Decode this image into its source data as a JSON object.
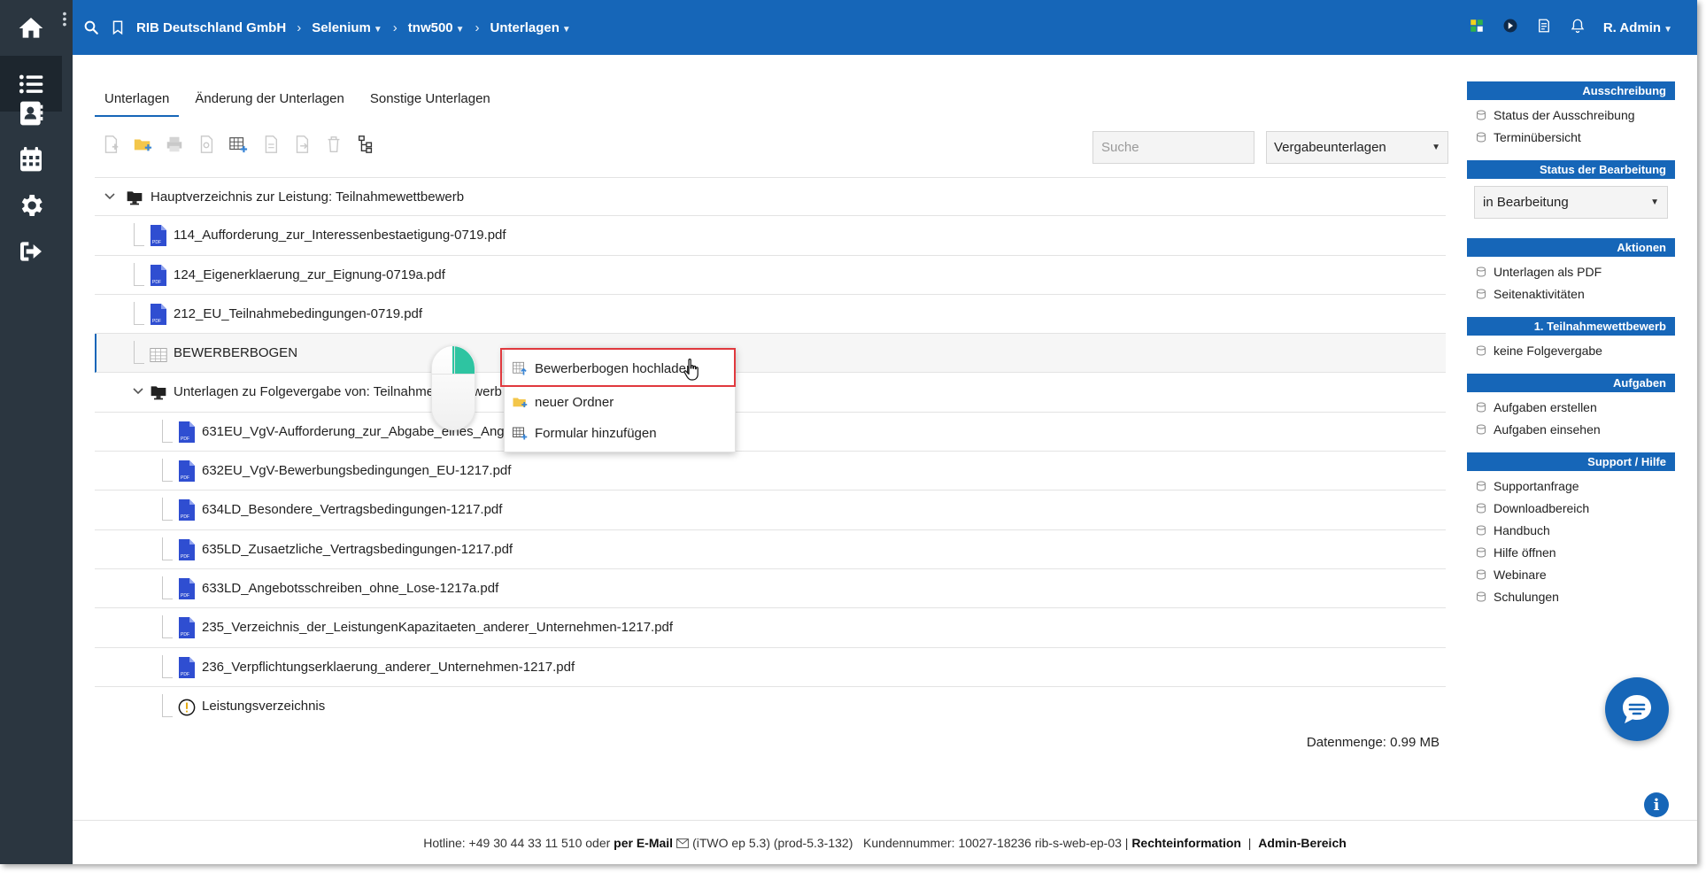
{
  "header": {
    "crumbs": [
      {
        "label": "RIB Deutschland GmbH",
        "dropdown": false
      },
      {
        "label": "Selenium",
        "dropdown": true
      },
      {
        "label": "tnw500",
        "dropdown": true
      },
      {
        "label": "Unterlagen",
        "dropdown": true
      }
    ],
    "user": "R. Admin"
  },
  "rail": [
    "home-icon",
    "list-icon",
    "contacts-icon",
    "calendar-icon",
    "gear-icon",
    "logout-icon"
  ],
  "tabs": [
    {
      "label": "Unterlagen",
      "active": true
    },
    {
      "label": "Änderung der Unterlagen",
      "active": false
    },
    {
      "label": "Sonstige Unterlagen",
      "active": false
    }
  ],
  "toolbar": {
    "search_placeholder": "Suche",
    "filter_value": "Vergabeunterlagen"
  },
  "tree": [
    {
      "label": "Hauptverzeichnis zur Leistung: Teilnahmewettbewerb",
      "type": "folder",
      "level": 0,
      "expanded": true
    },
    {
      "label": "114_Aufforderung_zur_Interessenbestaetigung-0719.pdf",
      "type": "pdf",
      "level": 1
    },
    {
      "label": "124_Eigenerklaerung_zur_Eignung-0719a.pdf",
      "type": "pdf",
      "level": 1
    },
    {
      "label": "212_EU_Teilnahmebedingungen-0719.pdf",
      "type": "pdf",
      "level": 1
    },
    {
      "label": "BEWERBERBOGEN",
      "type": "form",
      "level": 1,
      "selected": true
    },
    {
      "label": "Unterlagen zu Folgevergabe von: Teilnahmewettbewerb",
      "type": "folder",
      "level": 1,
      "expanded": true
    },
    {
      "label": "631EU_VgV-Aufforderung_zur_Abgabe_eines_Angebots-1217.pdf",
      "type": "pdf",
      "level": 2
    },
    {
      "label": "632EU_VgV-Bewerbungsbedingungen_EU-1217.pdf",
      "type": "pdf",
      "level": 2
    },
    {
      "label": "634LD_Besondere_Vertragsbedingungen-1217.pdf",
      "type": "pdf",
      "level": 2
    },
    {
      "label": "635LD_Zusaetzliche_Vertragsbedingungen-1217.pdf",
      "type": "pdf",
      "level": 2
    },
    {
      "label": "633LD_Angebotsschreiben_ohne_Lose-1217a.pdf",
      "type": "pdf",
      "level": 2
    },
    {
      "label": "235_Verzeichnis_der_LeistungenKapazitaeten_anderer_Unternehmen-1217.pdf",
      "type": "pdf",
      "level": 2
    },
    {
      "label": "236_Verpflichtungserklaerung_anderer_Unternehmen-1217.pdf",
      "type": "pdf",
      "level": 2
    },
    {
      "label": "Leistungsverzeichnis",
      "type": "warning",
      "level": 2
    }
  ],
  "datasize": "Datenmenge: 0.99 MB",
  "context_menu": [
    {
      "label": "Bewerberbogen hochladen",
      "icon": "upload-form-icon",
      "highlighted": true
    },
    {
      "label": "neuer Ordner",
      "icon": "new-folder-icon"
    },
    {
      "label": "Formular hinzufügen",
      "icon": "add-form-icon"
    }
  ],
  "panel": {
    "ausschreibung": {
      "title": "Ausschreibung",
      "links": [
        "Status der Ausschreibung",
        "Terminübersicht"
      ]
    },
    "status": {
      "title": "Status der Bearbeitung",
      "value": "in Bearbeitung"
    },
    "aktionen": {
      "title": "Aktionen",
      "links": [
        "Unterlagen als PDF",
        "Seitenaktivitäten"
      ]
    },
    "teilnahme": {
      "title": "1. Teilnahmewettbewerb",
      "links": [
        "keine Folgevergabe"
      ]
    },
    "aufgaben": {
      "title": "Aufgaben",
      "links": [
        "Aufgaben erstellen",
        "Aufgaben einsehen"
      ]
    },
    "support": {
      "title": "Support / Hilfe",
      "links": [
        "Supportanfrage",
        "Downloadbereich",
        "Handbuch",
        "Hilfe öffnen",
        "Webinare",
        "Schulungen"
      ]
    }
  },
  "footer": {
    "hotline": "Hotline: +49 30 44 33 11 510 oder",
    "mail_label": "per E-Mail",
    "version": "(iTWO ep 5.3) (prod-5.3-132)",
    "customer": "Kundennummer: 10027-18236 rib-s-web-ep-03 |",
    "legal": "Rechteinformation",
    "sep": "|",
    "admin": "Admin-Bereich"
  },
  "colors": {
    "brand": "#1666b8",
    "rail": "#2b3640",
    "highlight": "#e0393e",
    "mouse_accent": "#2ec4a1"
  }
}
